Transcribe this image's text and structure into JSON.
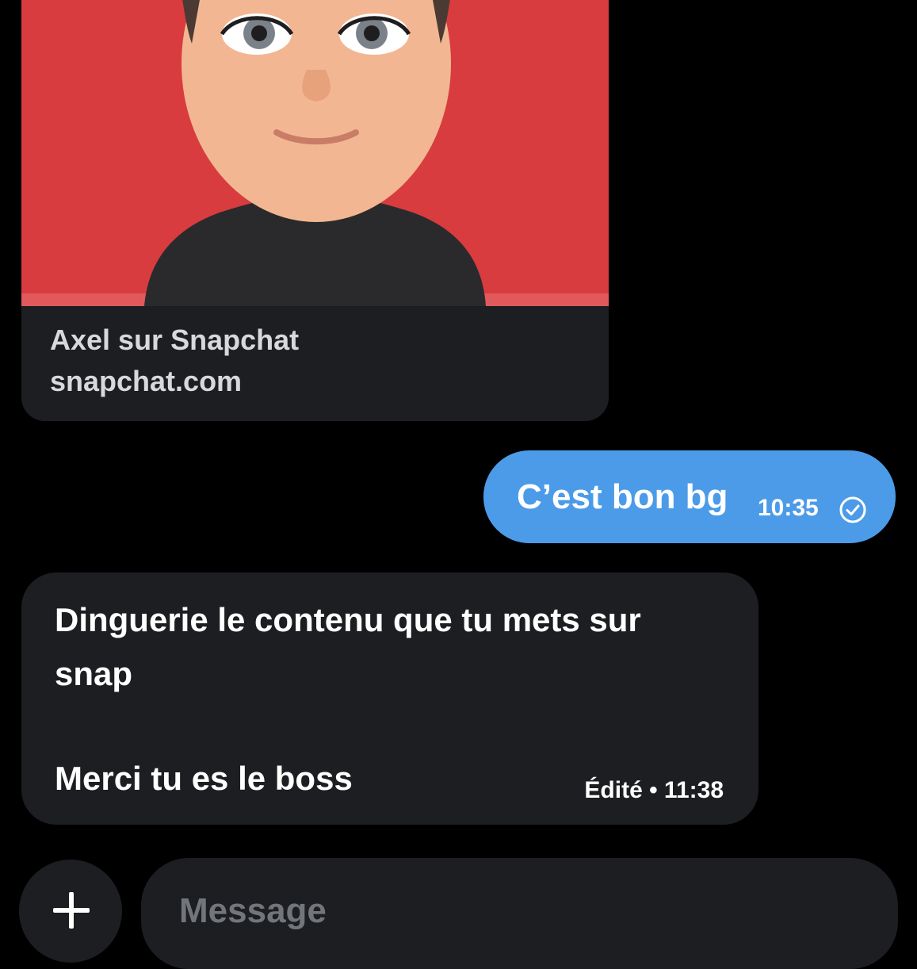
{
  "link_preview": {
    "title": "Axel sur Snapchat",
    "domain": "snapchat.com",
    "image": "bitmoji-avatar-on-red-background"
  },
  "messages": [
    {
      "direction": "sent",
      "text": "C’est bon bg",
      "time": "10:35",
      "status_icon": "check-circle-icon"
    },
    {
      "direction": "received",
      "lines": [
        "Dinguerie le contenu que tu mets sur",
        "snap",
        "Merci tu es le boss"
      ],
      "meta": "Édité • 11:38"
    }
  ],
  "composer": {
    "add_icon": "plus-icon",
    "placeholder": "Message"
  },
  "colors": {
    "background": "#000000",
    "bubble_received": "#1d1e21",
    "bubble_sent": "#4c9be8",
    "preview_image_bg": "#d83c3f",
    "placeholder": "#72767b"
  }
}
